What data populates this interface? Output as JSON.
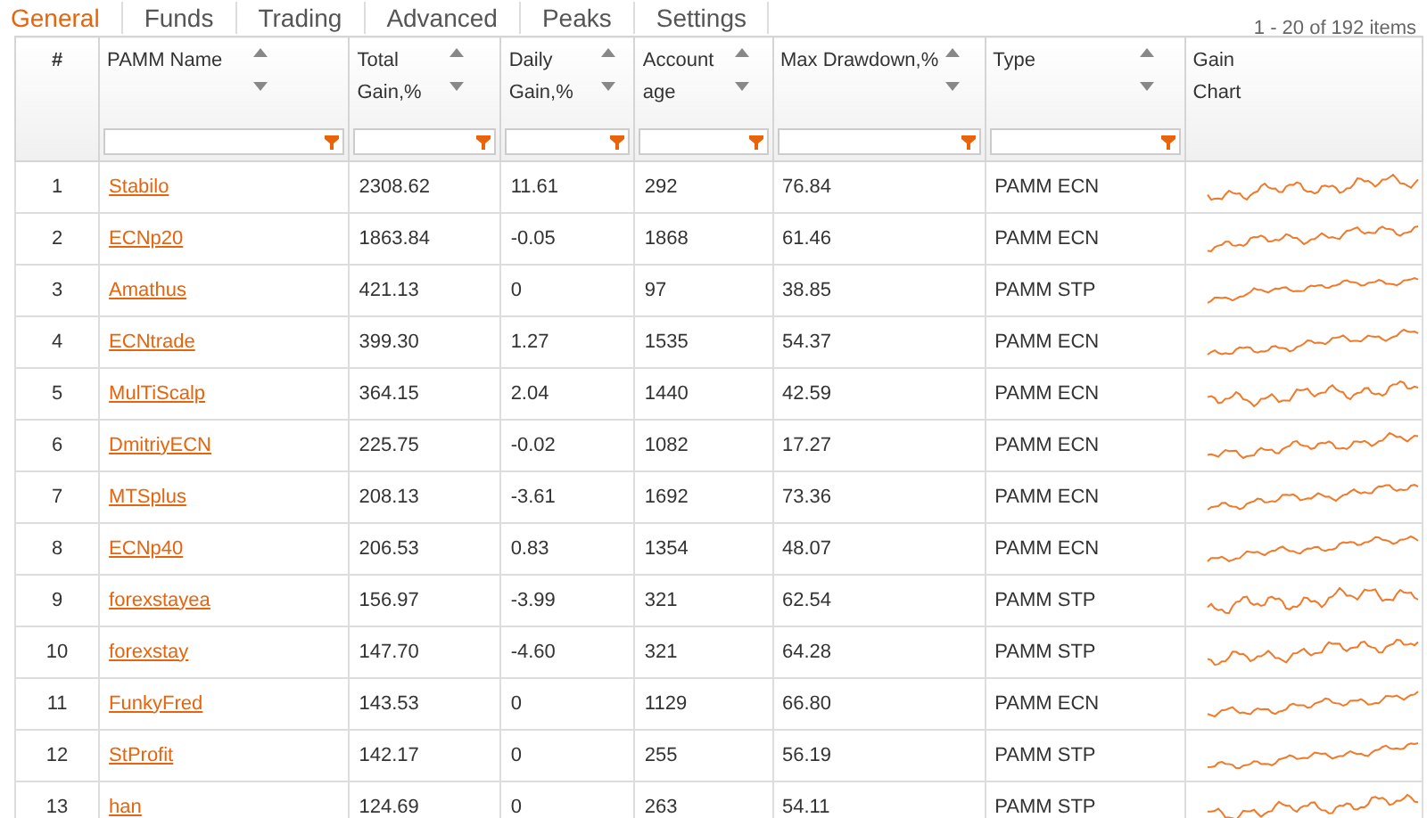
{
  "tabs": [
    {
      "label": "General",
      "selected": true
    },
    {
      "label": "Funds",
      "selected": false
    },
    {
      "label": "Trading",
      "selected": false
    },
    {
      "label": "Advanced",
      "selected": false
    },
    {
      "label": "Peaks",
      "selected": false
    },
    {
      "label": "Settings",
      "selected": false
    }
  ],
  "pager": "1 - 20 of 192 items",
  "table": {
    "columns": [
      {
        "title": "#",
        "sortable": false,
        "filter": false
      },
      {
        "title": "PAMM Name",
        "sortable": true,
        "filter": true
      },
      {
        "title": "Total Gain,%",
        "sortable": true,
        "filter": true
      },
      {
        "title": "Daily Gain,%",
        "sortable": true,
        "filter": true
      },
      {
        "title": "Account age",
        "sortable": true,
        "filter": true
      },
      {
        "title": "Max Drawdown,%",
        "sortable": true,
        "filter": true
      },
      {
        "title": "Type",
        "sortable": true,
        "filter": true
      },
      {
        "title": "Gain Chart",
        "sortable": false,
        "filter": false
      }
    ],
    "rows": [
      [
        "1",
        "Stabilo",
        "2308.62",
        "11.61",
        "292",
        "76.84",
        "PAMM ECN"
      ],
      [
        "2",
        "ECNp20",
        "1863.84",
        "-0.05",
        "1868",
        "61.46",
        "PAMM ECN"
      ],
      [
        "3",
        "Amathus",
        "421.13",
        "0",
        "97",
        "38.85",
        "PAMM STP"
      ],
      [
        "4",
        "ECNtrade",
        "399.30",
        "1.27",
        "1535",
        "54.37",
        "PAMM ECN"
      ],
      [
        "5",
        "MulTiScalp",
        "364.15",
        "2.04",
        "1440",
        "42.59",
        "PAMM ECN"
      ],
      [
        "6",
        "DmitriyECN",
        "225.75",
        "-0.02",
        "1082",
        "17.27",
        "PAMM ECN"
      ],
      [
        "7",
        "MTSplus",
        "208.13",
        "-3.61",
        "1692",
        "73.36",
        "PAMM ECN"
      ],
      [
        "8",
        "ECNp40",
        "206.53",
        "0.83",
        "1354",
        "48.07",
        "PAMM ECN"
      ],
      [
        "9",
        "forexstayea",
        "156.97",
        "-3.99",
        "321",
        "62.54",
        "PAMM STP"
      ],
      [
        "10",
        "forexstay",
        "147.70",
        "-4.60",
        "321",
        "64.28",
        "PAMM STP"
      ],
      [
        "11",
        "FunkyFred",
        "143.53",
        "0",
        "1129",
        "66.80",
        "PAMM ECN"
      ],
      [
        "12",
        "StProfit",
        "142.17",
        "0",
        "255",
        "56.19",
        "PAMM STP"
      ],
      [
        "13",
        "han",
        "124.69",
        "0",
        "263",
        "54.11",
        "PAMM STP"
      ]
    ]
  }
}
